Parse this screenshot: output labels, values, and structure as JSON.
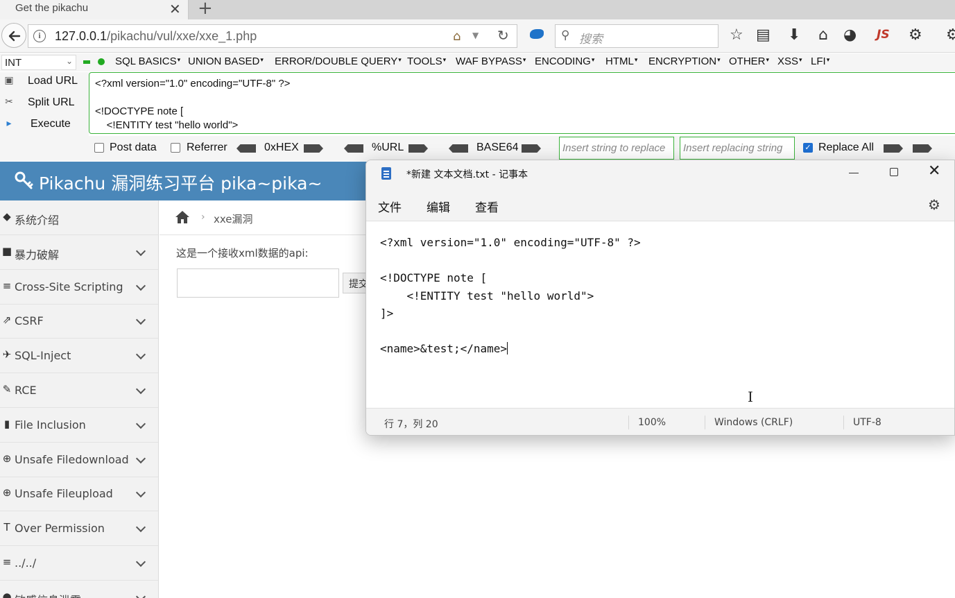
{
  "browser": {
    "tab_title": "Get the pikachu",
    "tab_close": "✕",
    "new_tab": "+",
    "url_host": "127.0.0.1",
    "url_path": "/pikachu/vul/xxe/xxe_1.php",
    "search_placeholder": "搜索",
    "js_label": "JS"
  },
  "hackbar": {
    "select_value": "INT",
    "menus": [
      "SQL BASICS",
      "UNION BASED",
      "ERROR/DOUBLE QUERY",
      "TOOLS",
      "WAF BYPASS",
      "ENCODING",
      "HTML",
      "ENCRYPTION",
      "OTHER",
      "XSS",
      "LFI"
    ],
    "actions": [
      "Load URL",
      "Split URL",
      "Execute"
    ],
    "url_text": "<?xml version=\"1.0\" encoding=\"UTF-8\" ?>\n\n<!DOCTYPE note [\n    <!ENTITY test \"hello world\">",
    "post_data_label": "Post data",
    "referrer_label": "Referrer",
    "hex_label": "0xHEX",
    "url_label": "%URL",
    "base64_label": "BASE64",
    "insert_placeholder": "Insert string to replace",
    "replacing_placeholder": "Insert replacing string",
    "replace_all_label": "Replace All"
  },
  "pikachu": {
    "title": "Pikachu 漏洞练习平台 pika~pika~",
    "breadcrumb": "xxe漏洞",
    "api_label": "这是一个接收xml数据的api:",
    "submit_label": "提交",
    "sidebar": [
      {
        "label": "系统介绍",
        "icon": "tags-icon",
        "glyph": "◆",
        "chevron": false
      },
      {
        "label": "暴力破解",
        "icon": "lock-icon",
        "glyph": "■",
        "chevron": true
      },
      {
        "label": "Cross-Site Scripting",
        "icon": "sitemap-icon",
        "glyph": "≡",
        "chevron": true
      },
      {
        "label": "CSRF",
        "icon": "share-icon",
        "glyph": "⇗",
        "chevron": true
      },
      {
        "label": "SQL-Inject",
        "icon": "fighter-jet-icon",
        "glyph": "✈",
        "chevron": true
      },
      {
        "label": "RCE",
        "icon": "pencil-icon",
        "glyph": "✎",
        "chevron": true
      },
      {
        "label": "File Inclusion",
        "icon": "file-icon",
        "glyph": "▮",
        "chevron": true
      },
      {
        "label": "Unsafe Filedownload",
        "icon": "download-icon",
        "glyph": "⊕",
        "chevron": true
      },
      {
        "label": "Unsafe Fileupload",
        "icon": "upload-icon",
        "glyph": "⊕",
        "chevron": true
      },
      {
        "label": "Over Permission",
        "icon": "text-height-icon",
        "glyph": "T",
        "chevron": true
      },
      {
        "label": "../../",
        "icon": "align-left-icon",
        "glyph": "≡",
        "chevron": true
      },
      {
        "label": "敏感信息泄露",
        "icon": "eye-icon",
        "glyph": "●",
        "chevron": true
      }
    ]
  },
  "notepad": {
    "title": "*新建 文本文档.txt - 记事本",
    "menus": [
      "文件",
      "编辑",
      "查看"
    ],
    "content": "<?xml version=\"1.0\" encoding=\"UTF-8\" ?>\n\n<!DOCTYPE note [\n    <!ENTITY test \"hello world\">\n]>\n\n<name>&test;</name>",
    "status_position": "行 7，列 20",
    "status_zoom": "100%",
    "status_eol": "Windows (CRLF)",
    "status_encoding": "UTF-8"
  }
}
